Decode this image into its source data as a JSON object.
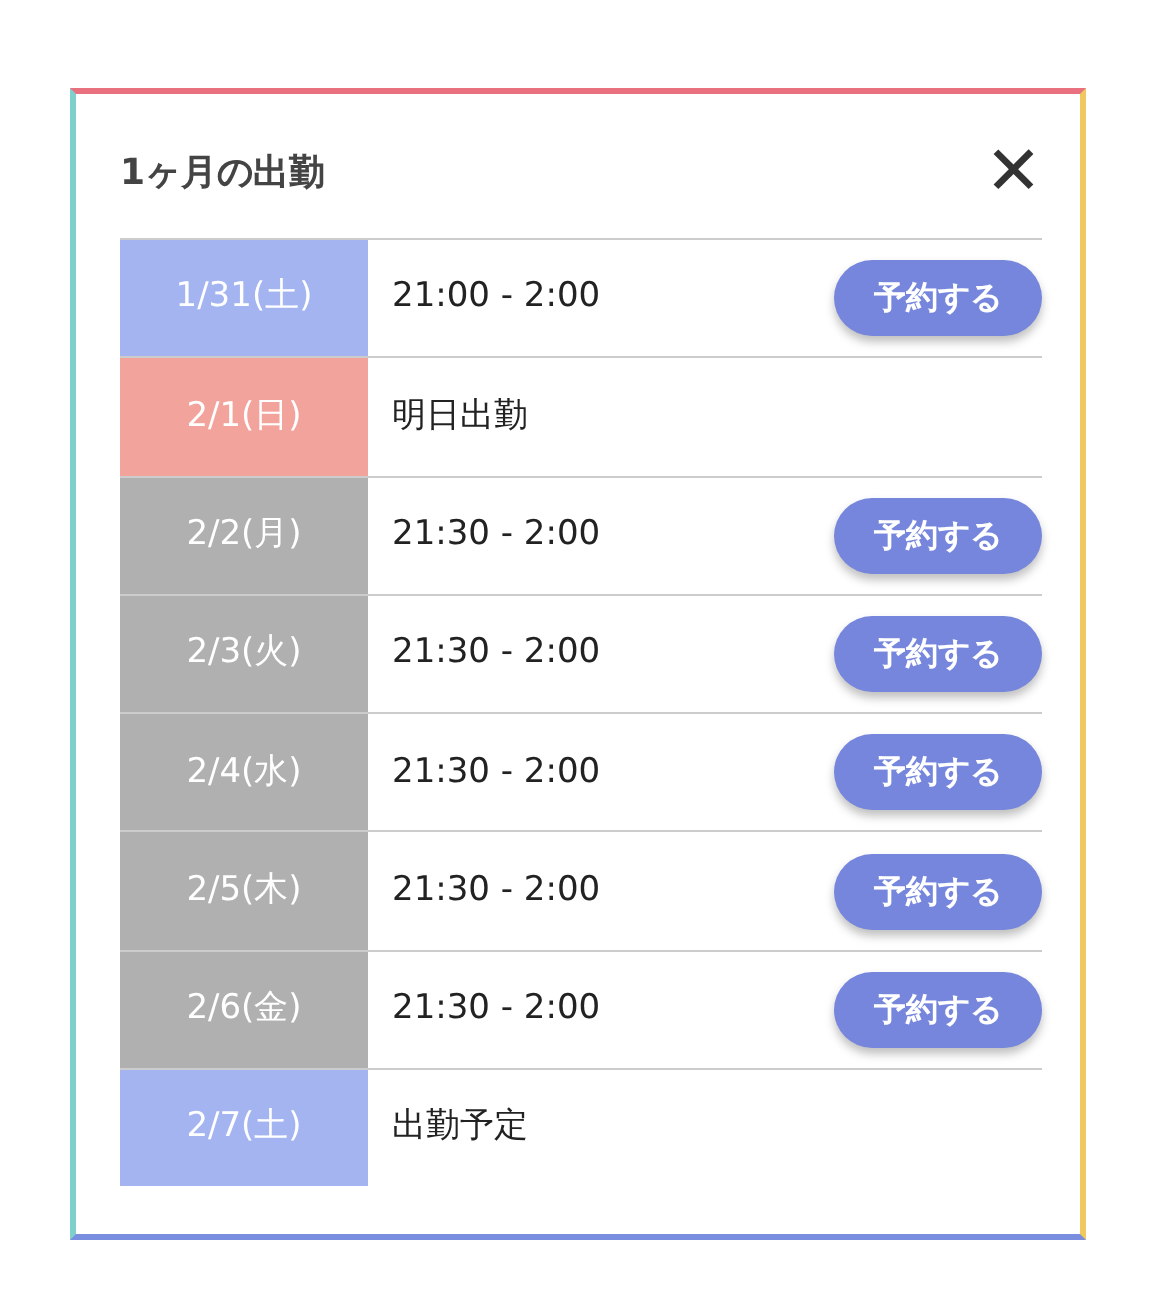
{
  "dialog": {
    "title": "1ヶ月の出勤",
    "close_label": "✕"
  },
  "rows": [
    {
      "date": "1/31(土)",
      "color": "#a3b4f0",
      "text": "21:00 - 2:00",
      "button": "予約する"
    },
    {
      "date": "2/1(日)",
      "color": "#f2a49c",
      "text": "明日出勤"
    },
    {
      "date": "2/2(月)",
      "color": "#b0b0b0",
      "text": "21:30 - 2:00",
      "button": "予約する"
    },
    {
      "date": "2/3(火)",
      "color": "#b0b0b0",
      "text": "21:30 - 2:00",
      "button": "予約する"
    },
    {
      "date": "2/4(水)",
      "color": "#b0b0b0",
      "text": "21:30 - 2:00",
      "button": "予約する"
    },
    {
      "date": "2/5(木)",
      "color": "#b0b0b0",
      "text": "21:30 - 2:00",
      "button": "予約する"
    },
    {
      "date": "2/6(金)",
      "color": "#b0b0b0",
      "text": "21:30 - 2:00",
      "button": "予約する"
    },
    {
      "date": "2/7(土)",
      "color": "#a3b4f0",
      "text": "出勤予定"
    }
  ]
}
